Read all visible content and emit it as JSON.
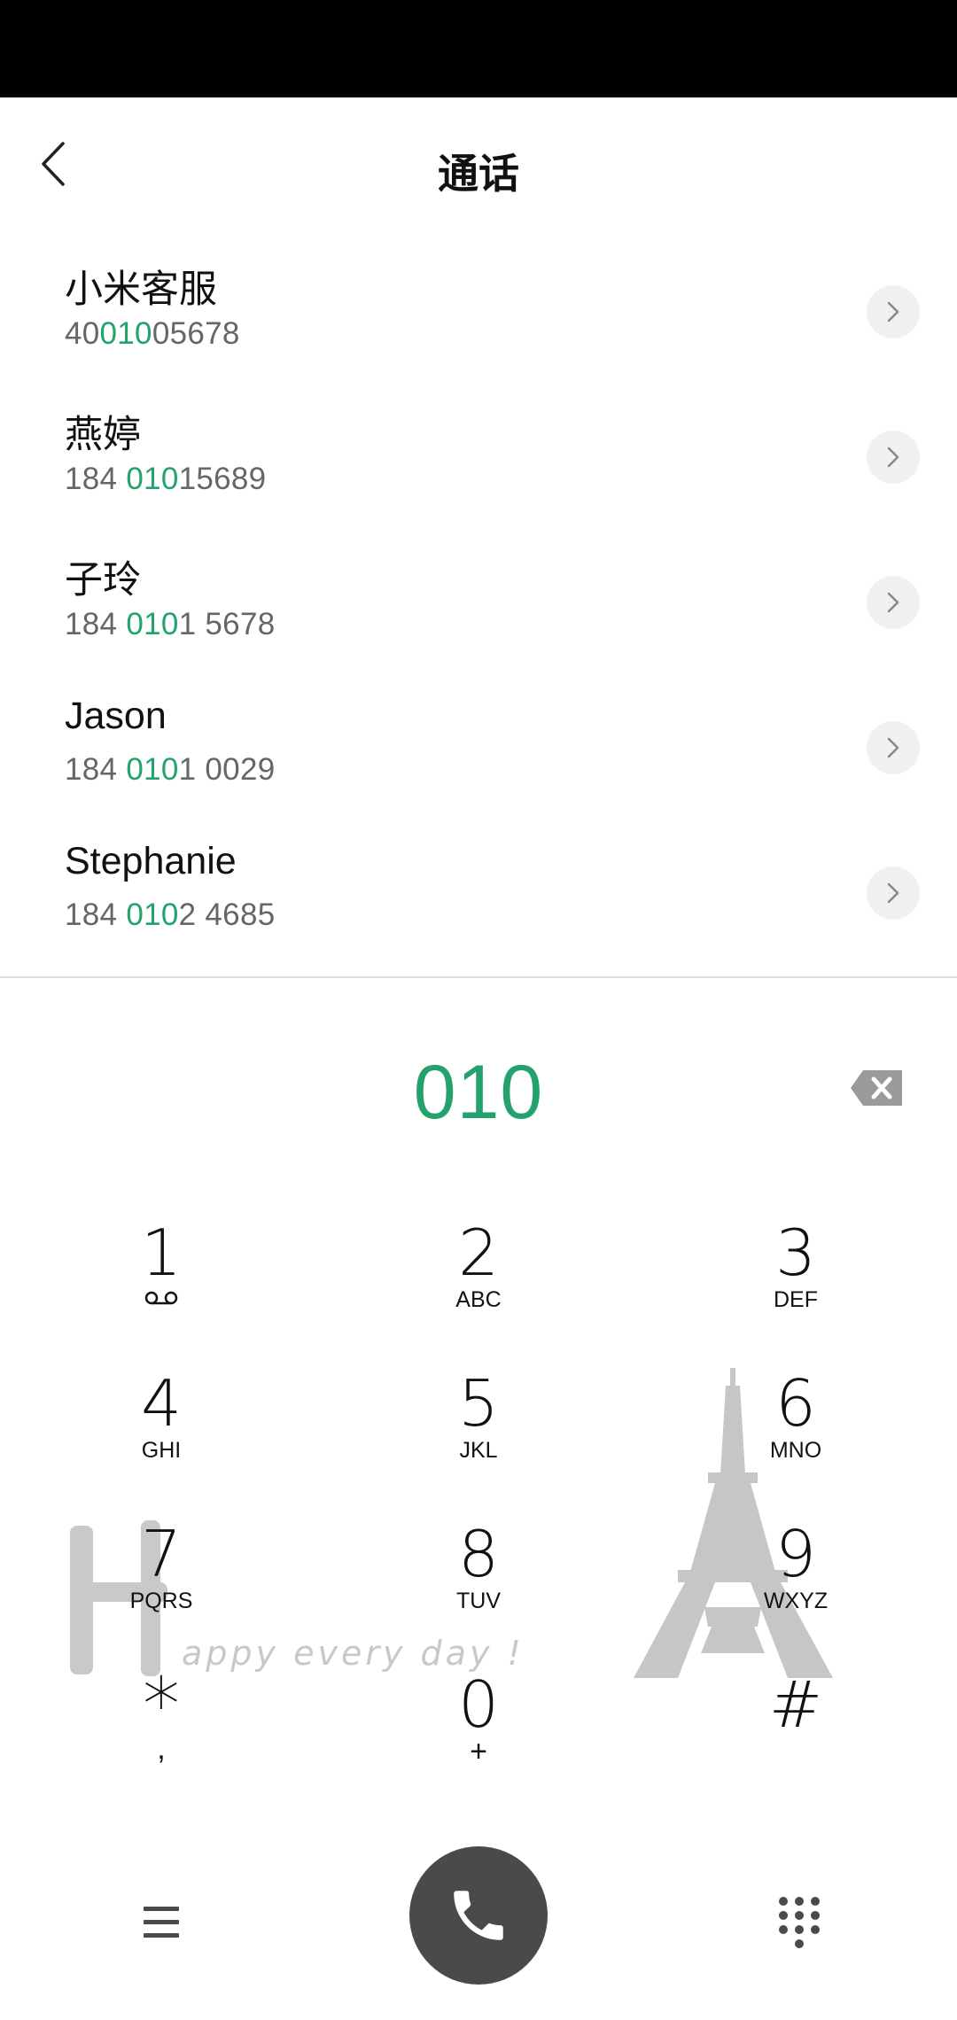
{
  "header": {
    "title": "通话"
  },
  "contacts": [
    {
      "name": "小米客服",
      "number_pre": "40",
      "number_match": "010",
      "number_post": "05678"
    },
    {
      "name": "燕婷",
      "number_pre": "184 ",
      "number_match": "010",
      "number_post": "15689"
    },
    {
      "name": "子玲",
      "number_pre": "184 ",
      "number_match": "010",
      "number_post": "1 5678"
    },
    {
      "name": "Jason",
      "number_pre": "184 ",
      "number_match": "010",
      "number_post": "1 0029"
    },
    {
      "name": "Stephanie",
      "number_pre": "184 ",
      "number_match": "010",
      "number_post": "2 4685"
    }
  ],
  "dialer": {
    "input": "010"
  },
  "keypad": [
    {
      "digit": "1",
      "sub": ""
    },
    {
      "digit": "2",
      "sub": "ABC"
    },
    {
      "digit": "3",
      "sub": "DEF"
    },
    {
      "digit": "4",
      "sub": "GHI"
    },
    {
      "digit": "5",
      "sub": "JKL"
    },
    {
      "digit": "6",
      "sub": "MNO"
    },
    {
      "digit": "7",
      "sub": "PQRS"
    },
    {
      "digit": "8",
      "sub": "TUV"
    },
    {
      "digit": "9",
      "sub": "WXYZ"
    },
    {
      "digit": "*",
      "sub": ","
    },
    {
      "digit": "0",
      "sub": "+"
    },
    {
      "digit": "#",
      "sub": ""
    }
  ],
  "theme": {
    "accent": "#23a36b",
    "call_button": "#4a4a4a"
  },
  "icons": {
    "back": "chevron-left-icon",
    "detail": "chevron-right-icon",
    "backspace": "backspace-icon",
    "voicemail": "voicemail-icon",
    "menu": "menu-icon",
    "call": "phone-icon",
    "dialpad": "dialpad-icon"
  },
  "wallpaper": {
    "text": "appy every day !"
  }
}
